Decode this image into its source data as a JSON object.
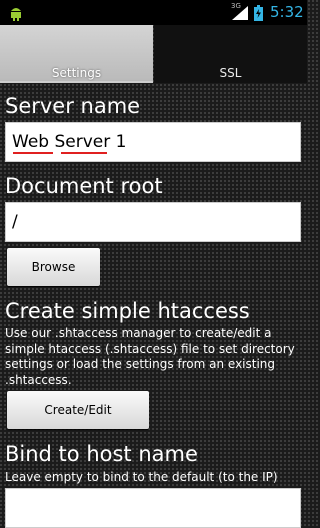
{
  "status_bar": {
    "network": "3G",
    "time": "5:32",
    "icons": [
      "android-debug-icon",
      "signal-icon",
      "battery-icon"
    ]
  },
  "tabs": [
    {
      "label": "Settings",
      "active": true
    },
    {
      "label": "SSL",
      "active": false
    }
  ],
  "form": {
    "server_name": {
      "label": "Server name",
      "value": "Web Server 1"
    },
    "document_root": {
      "label": "Document root",
      "value": "/"
    },
    "browse_button": "Browse",
    "htaccess": {
      "label": "Create simple htaccess",
      "description": "Use our .shtaccess manager to create/edit a simple htaccess (.shtaccess) file to set directory settings or load the settings from an existing .shtaccess.",
      "button": "Create/Edit"
    },
    "bind_host": {
      "label": "Bind to host name",
      "description": "Leave empty to bind to the default (to the IP)",
      "value": ""
    }
  },
  "colors": {
    "accent": "#34b5e5",
    "tab_active": "#c8c8c8",
    "background": "#1b1b1b"
  }
}
